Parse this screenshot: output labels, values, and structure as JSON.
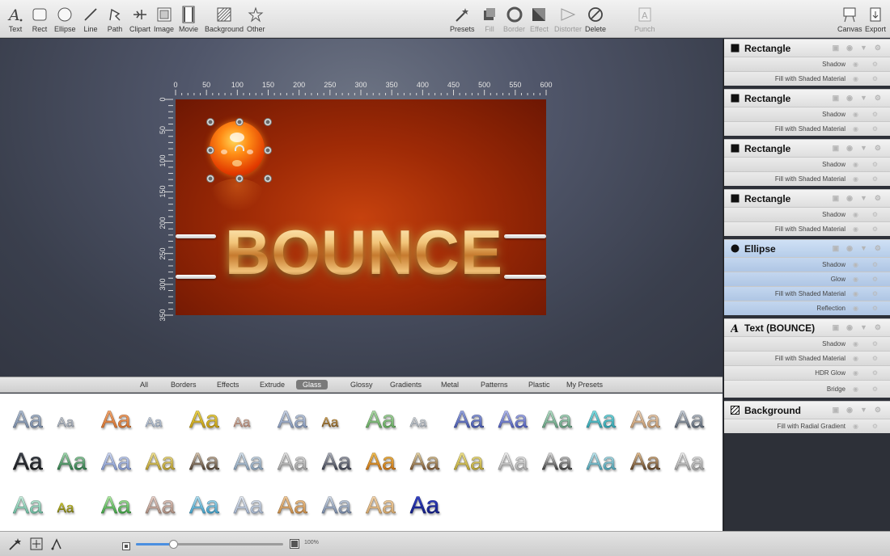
{
  "toolbar": {
    "left_tools": [
      {
        "label": "Text",
        "icon": "text-tool-icon"
      },
      {
        "label": "Rect",
        "icon": "rect-tool-icon"
      },
      {
        "label": "Ellipse",
        "icon": "ellipse-tool-icon"
      },
      {
        "label": "Line",
        "icon": "line-tool-icon"
      },
      {
        "label": "Path",
        "icon": "path-tool-icon"
      },
      {
        "label": "Clipart",
        "icon": "clipart-tool-icon"
      },
      {
        "label": "Image",
        "icon": "image-tool-icon"
      },
      {
        "label": "Movie",
        "icon": "movie-tool-icon"
      },
      {
        "label": "Background",
        "icon": "background-tool-icon"
      },
      {
        "label": "Other",
        "icon": "other-tool-icon"
      }
    ],
    "center_tools": [
      {
        "label": "Presets",
        "icon": "presets-wand-icon",
        "enabled": true
      },
      {
        "label": "Fill",
        "icon": "fill-icon",
        "enabled": false
      },
      {
        "label": "Border",
        "icon": "border-icon",
        "enabled": false
      },
      {
        "label": "Effect",
        "icon": "effect-icon",
        "enabled": false
      },
      {
        "label": "Distorter",
        "icon": "distorter-icon",
        "enabled": false
      },
      {
        "label": "Delete",
        "icon": "delete-icon",
        "enabled": true
      },
      {
        "label": "Punch",
        "icon": "punch-icon",
        "enabled": false
      }
    ],
    "right_tools": [
      {
        "label": "Canvas",
        "icon": "canvas-icon"
      },
      {
        "label": "Export",
        "icon": "export-icon"
      }
    ]
  },
  "rulers": {
    "top": [
      "0",
      "50",
      "100",
      "150",
      "200",
      "250",
      "300",
      "350",
      "400",
      "450",
      "500",
      "550",
      "600"
    ],
    "left": [
      "0",
      "50",
      "100",
      "150",
      "200",
      "250",
      "300",
      "350"
    ]
  },
  "artwork": {
    "text": "BOUNCE"
  },
  "preset_tabs": {
    "items": [
      "All",
      "Borders",
      "Effects",
      "Extrude",
      "Glass",
      "Glossy",
      "Gradients",
      "Metal",
      "Patterns",
      "Plastic",
      "My Presets"
    ],
    "active": "Glass"
  },
  "preset_sample_text": "Aa",
  "statusbar": {
    "zoom_label": "100%",
    "zoom_fraction": 0.25
  },
  "layers": [
    {
      "name": "Rectangle",
      "icon": "square",
      "selected": false,
      "effects": [
        "Shadow",
        "Fill with Shaded Material"
      ]
    },
    {
      "name": "Rectangle",
      "icon": "square",
      "selected": false,
      "effects": [
        "Shadow",
        "Fill with Shaded Material"
      ]
    },
    {
      "name": "Rectangle",
      "icon": "square",
      "selected": false,
      "effects": [
        "Shadow",
        "Fill with Shaded Material"
      ]
    },
    {
      "name": "Rectangle",
      "icon": "square",
      "selected": false,
      "effects": [
        "Shadow",
        "Fill with Shaded Material"
      ]
    },
    {
      "name": "Ellipse",
      "icon": "circle",
      "selected": true,
      "effects": [
        "Shadow",
        "Glow",
        "Fill with Shaded Material",
        "Reflection"
      ]
    },
    {
      "name": "Text (BOUNCE)",
      "icon": "text",
      "selected": false,
      "effects": [
        "Shadow",
        "Fill with Shaded Material",
        "HDR Glow",
        "Bridge"
      ]
    },
    {
      "name": "Background",
      "icon": "hatch",
      "selected": false,
      "effects": [
        "Fill with Radial Gradient"
      ]
    }
  ],
  "colors": {
    "accent_blue": "#4a8fe0",
    "selection_blue": "#b6cde9",
    "artboard_red": "#9e2a06"
  }
}
